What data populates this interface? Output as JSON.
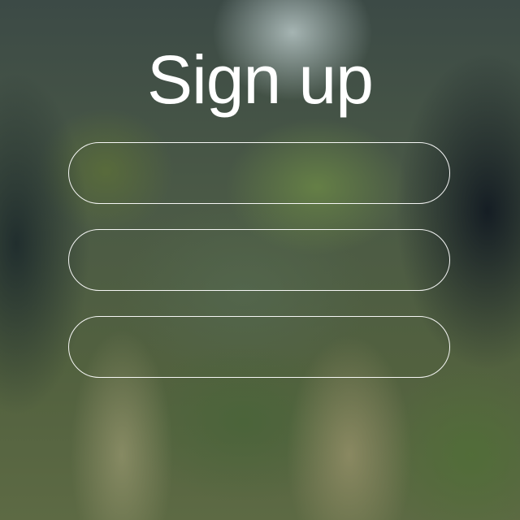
{
  "page": {
    "title": "Sign up"
  },
  "form": {
    "fields": [
      {
        "value": "",
        "placeholder": ""
      },
      {
        "value": "",
        "placeholder": ""
      },
      {
        "value": "",
        "placeholder": ""
      }
    ]
  },
  "colors": {
    "text": "#ffffff",
    "field_border": "#ffffff"
  }
}
